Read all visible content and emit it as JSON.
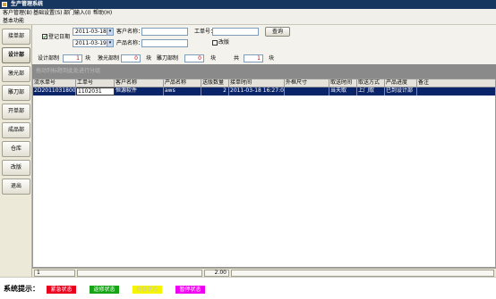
{
  "window": {
    "title": "生产管理系统"
  },
  "menu": {
    "items": [
      "客户管理(B)",
      "基础设置(S)",
      "部门输入(I)",
      "帮助(H)"
    ]
  },
  "toolbar": {
    "label": "基本功能"
  },
  "sidebar": {
    "items": [
      {
        "label": "接单部"
      },
      {
        "label": "设计部"
      },
      {
        "label": "激光部"
      },
      {
        "label": "雕刀部"
      },
      {
        "label": "开单部"
      },
      {
        "label": "成品部"
      },
      {
        "label": "仓库"
      },
      {
        "label": "改版"
      },
      {
        "label": "退出"
      }
    ],
    "active_index": 1
  },
  "filters": {
    "date_checkbox_label": "登记日期",
    "date_from": "2011-03-18",
    "date_to": "2011-03-19",
    "customer_label": "客户名称：",
    "customer_value": "",
    "order_label": "工单号：",
    "order_value": "",
    "product_label": "产品名称：",
    "product_value": "",
    "revision_label": "改版",
    "query_button": "查询"
  },
  "stats": {
    "design_label": "设计部制",
    "design_value": "1",
    "design_unit": "块",
    "laser_label": "激光部制",
    "laser_value": "0",
    "laser_unit": "块",
    "carve_label": "雕刀部制",
    "carve_value": "0",
    "carve_unit": "块",
    "total_label": "共",
    "total_value": "1",
    "total_unit": "块"
  },
  "group_band": {
    "text": "拖动列标题到此处进行分组"
  },
  "grid": {
    "columns": [
      "流水单号",
      "工单号",
      "客户名称",
      "产品名称",
      "送版数量",
      "接单时间",
      "外框尺寸",
      "取送时间",
      "取送方式",
      "产品进度",
      "备注"
    ],
    "rows": [
      [
        "2D20110318001",
        "1102031",
        "恒源软件",
        "aws",
        "2",
        "2011-03-18 16:27:07",
        "",
        "当天取",
        "上门取",
        "已到设计部",
        ""
      ]
    ]
  },
  "footer": {
    "count": "1",
    "total": "2.00"
  },
  "status": {
    "title": "系统提示：",
    "legend": [
      {
        "label": "紧急状态",
        "color": "#e8001c"
      },
      {
        "label": "返修状态",
        "color": "#16a316"
      },
      {
        "label": "修版状态",
        "color": "#f5f500"
      },
      {
        "label": "暂停状态",
        "color": "#f000f0"
      }
    ]
  }
}
